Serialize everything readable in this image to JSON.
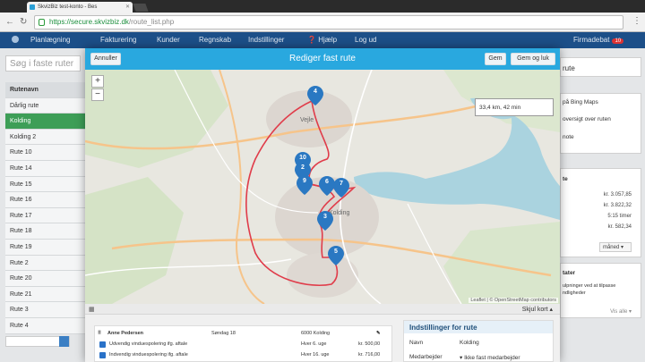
{
  "browser": {
    "tab_title": "SkvizBiz test-konto - Bes",
    "url_host": "https://secure.skvizbiz.dk",
    "url_path": "/route_list.php"
  },
  "nav": {
    "items": [
      "Planlægning",
      "Fakturering",
      "Kunder",
      "Regnskab",
      "Indstillinger",
      "Hjælp",
      "Log ud"
    ],
    "firm_label": "Firmadebat",
    "badge": "10"
  },
  "left": {
    "search_placeholder": "Søg i faste ruter",
    "header": "Rutenavn",
    "routes": [
      "Dårlig rute",
      "Kolding",
      "Kolding 2",
      "Rute 10",
      "Rute 14",
      "Rute 15",
      "Rute 16",
      "Rute 17",
      "Rute 18",
      "Rute 19",
      "Rute 2",
      "Rute 20",
      "Rute 21",
      "Rute 3",
      "Rute 4"
    ],
    "selected_index": 1
  },
  "right": {
    "rute": "rute",
    "maps_link": "på Bing Maps",
    "overview_link": "oversigt over ruten",
    "note": "note",
    "summary_title": "te",
    "values": [
      "kr. 3.057,85",
      "kr. 3.822,32",
      "5:15 timer",
      "kr. 582,34"
    ],
    "select_label": "måned",
    "status_title": "tater",
    "status_line1": "ulpninger ved at tilpasse",
    "status_line2": "ndligheder",
    "more": "Vis alle"
  },
  "modal": {
    "title": "Rediger fast rute",
    "cancel_label": "Annuller",
    "save_label": "Gem",
    "save_close_label": "Gem og luk",
    "zoom_in": "+",
    "zoom_out": "−",
    "tooltip": "33,4 km, 42 min",
    "attribution": "Leaflet | © OpenStreetMap contributors",
    "map_labels": {
      "town1": "Vejle",
      "town2": "Kolding"
    },
    "pins": [
      "4",
      "10",
      "2",
      "9",
      "6",
      "7",
      "3",
      "5"
    ],
    "hide_map_label": "Skjul kort",
    "stops": [
      {
        "name": "Anne Pedersen",
        "day": "Søndag 18",
        "city": "6000 Kolding",
        "price": ""
      },
      {
        "name": "Udvendig vinduespolering ifg. aftale",
        "day": "",
        "city": "Hver 6. uge",
        "price": "kr. 500,00"
      },
      {
        "name": "Indvendig vinduespolering ifg. aftale",
        "day": "",
        "city": "Hver 16. uge",
        "price": "kr. 716,00"
      }
    ],
    "settings": {
      "title": "Indstillinger for rute",
      "name_label": "Navn",
      "name_value": "Kolding",
      "worker_label": "Medarbejder",
      "worker_value": "Ikke fast medarbejder"
    }
  },
  "colors": {
    "accent": "#29a8df",
    "nav": "#1c4f88",
    "selected": "#3d9e57",
    "pin": "#2a78c2",
    "route": "#e03c4a",
    "water": "#aad3df"
  }
}
